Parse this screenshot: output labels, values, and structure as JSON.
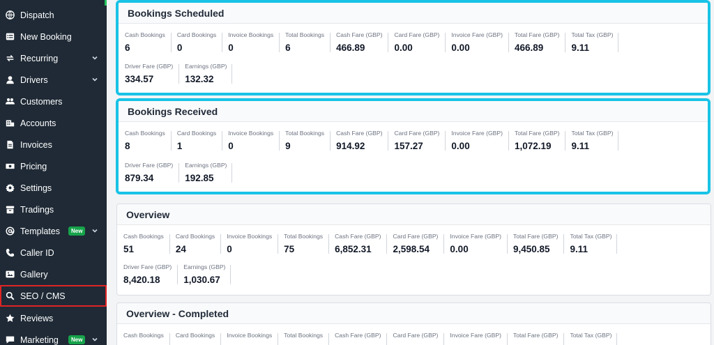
{
  "sidebar": {
    "items": [
      {
        "label": "Dispatch",
        "icon": "globe-icon"
      },
      {
        "label": "New Booking",
        "icon": "list-icon"
      },
      {
        "label": "Recurring",
        "icon": "recurring-arrows-icon",
        "has_submenu": true
      },
      {
        "label": "Drivers",
        "icon": "user-icon",
        "has_submenu": true
      },
      {
        "label": "Customers",
        "icon": "users-icon"
      },
      {
        "label": "Accounts",
        "icon": "accounts-icon"
      },
      {
        "label": "Invoices",
        "icon": "file-icon"
      },
      {
        "label": "Pricing",
        "icon": "money-icon"
      },
      {
        "label": "Settings",
        "icon": "gear-icon"
      },
      {
        "label": "Tradings",
        "icon": "archive-icon"
      },
      {
        "label": "Templates",
        "icon": "at-icon",
        "badge": "New",
        "has_submenu": true
      },
      {
        "label": "Caller ID",
        "icon": "phone-icon"
      },
      {
        "label": "Gallery",
        "icon": "image-icon"
      },
      {
        "label": "SEO / CMS",
        "icon": "search-icon",
        "active": true
      },
      {
        "label": "Reviews",
        "icon": "star-icon"
      },
      {
        "label": "Marketing",
        "icon": "message-icon",
        "badge": "New",
        "has_submenu": true
      }
    ],
    "colors": {
      "background": "#1f2a36",
      "active_outline": "#e02424",
      "badge": "#16a34a"
    }
  },
  "cards": [
    {
      "title": "Bookings Scheduled",
      "highlighted": true,
      "row1": [
        {
          "label": "Cash Bookings",
          "value": "6"
        },
        {
          "label": "Card Bookings",
          "value": "0"
        },
        {
          "label": "Invoice Bookings",
          "value": "0"
        },
        {
          "label": "Total Bookings",
          "value": "6"
        },
        {
          "label": "Cash Fare (GBP)",
          "value": "466.89"
        },
        {
          "label": "Card Fare (GBP)",
          "value": "0.00"
        },
        {
          "label": "Invoice Fare (GBP)",
          "value": "0.00"
        },
        {
          "label": "Total Fare (GBP)",
          "value": "466.89"
        },
        {
          "label": "Total Tax (GBP)",
          "value": "9.11"
        }
      ],
      "row2": [
        {
          "label": "Driver Fare (GBP)",
          "value": "334.57"
        },
        {
          "label": "Earnings (GBP)",
          "value": "132.32"
        }
      ]
    },
    {
      "title": "Bookings Received",
      "highlighted": true,
      "row1": [
        {
          "label": "Cash Bookings",
          "value": "8"
        },
        {
          "label": "Card Bookings",
          "value": "1"
        },
        {
          "label": "Invoice Bookings",
          "value": "0"
        },
        {
          "label": "Total Bookings",
          "value": "9"
        },
        {
          "label": "Cash Fare (GBP)",
          "value": "914.92"
        },
        {
          "label": "Card Fare (GBP)",
          "value": "157.27"
        },
        {
          "label": "Invoice Fare (GBP)",
          "value": "0.00"
        },
        {
          "label": "Total Fare (GBP)",
          "value": "1,072.19"
        },
        {
          "label": "Total Tax (GBP)",
          "value": "9.11"
        }
      ],
      "row2": [
        {
          "label": "Driver Fare (GBP)",
          "value": "879.34"
        },
        {
          "label": "Earnings (GBP)",
          "value": "192.85"
        }
      ]
    },
    {
      "title": "Overview",
      "highlighted": false,
      "row1": [
        {
          "label": "Cash Bookings",
          "value": "51"
        },
        {
          "label": "Card Bookings",
          "value": "24"
        },
        {
          "label": "Invoice Bookings",
          "value": "0"
        },
        {
          "label": "Total Bookings",
          "value": "75"
        },
        {
          "label": "Cash Fare (GBP)",
          "value": "6,852.31"
        },
        {
          "label": "Card Fare (GBP)",
          "value": "2,598.54"
        },
        {
          "label": "Invoice Fare (GBP)",
          "value": "0.00"
        },
        {
          "label": "Total Fare (GBP)",
          "value": "9,450.85"
        },
        {
          "label": "Total Tax (GBP)",
          "value": "9.11"
        }
      ],
      "row2": [
        {
          "label": "Driver Fare (GBP)",
          "value": "8,420.18"
        },
        {
          "label": "Earnings (GBP)",
          "value": "1,030.67"
        }
      ]
    },
    {
      "title": "Overview - Completed",
      "highlighted": false,
      "row1": [
        {
          "label": "Cash Bookings",
          "value": ""
        },
        {
          "label": "Card Bookings",
          "value": ""
        },
        {
          "label": "Invoice Bookings",
          "value": ""
        },
        {
          "label": "Total Bookings",
          "value": ""
        },
        {
          "label": "Cash Fare (GBP)",
          "value": ""
        },
        {
          "label": "Card Fare (GBP)",
          "value": ""
        },
        {
          "label": "Invoice Fare (GBP)",
          "value": ""
        },
        {
          "label": "Total Fare (GBP)",
          "value": ""
        },
        {
          "label": "Total Tax (GBP)",
          "value": ""
        }
      ],
      "row2": []
    }
  ],
  "colors": {
    "highlight_border": "#19c3e6",
    "content_background": "#f3f4f6"
  }
}
